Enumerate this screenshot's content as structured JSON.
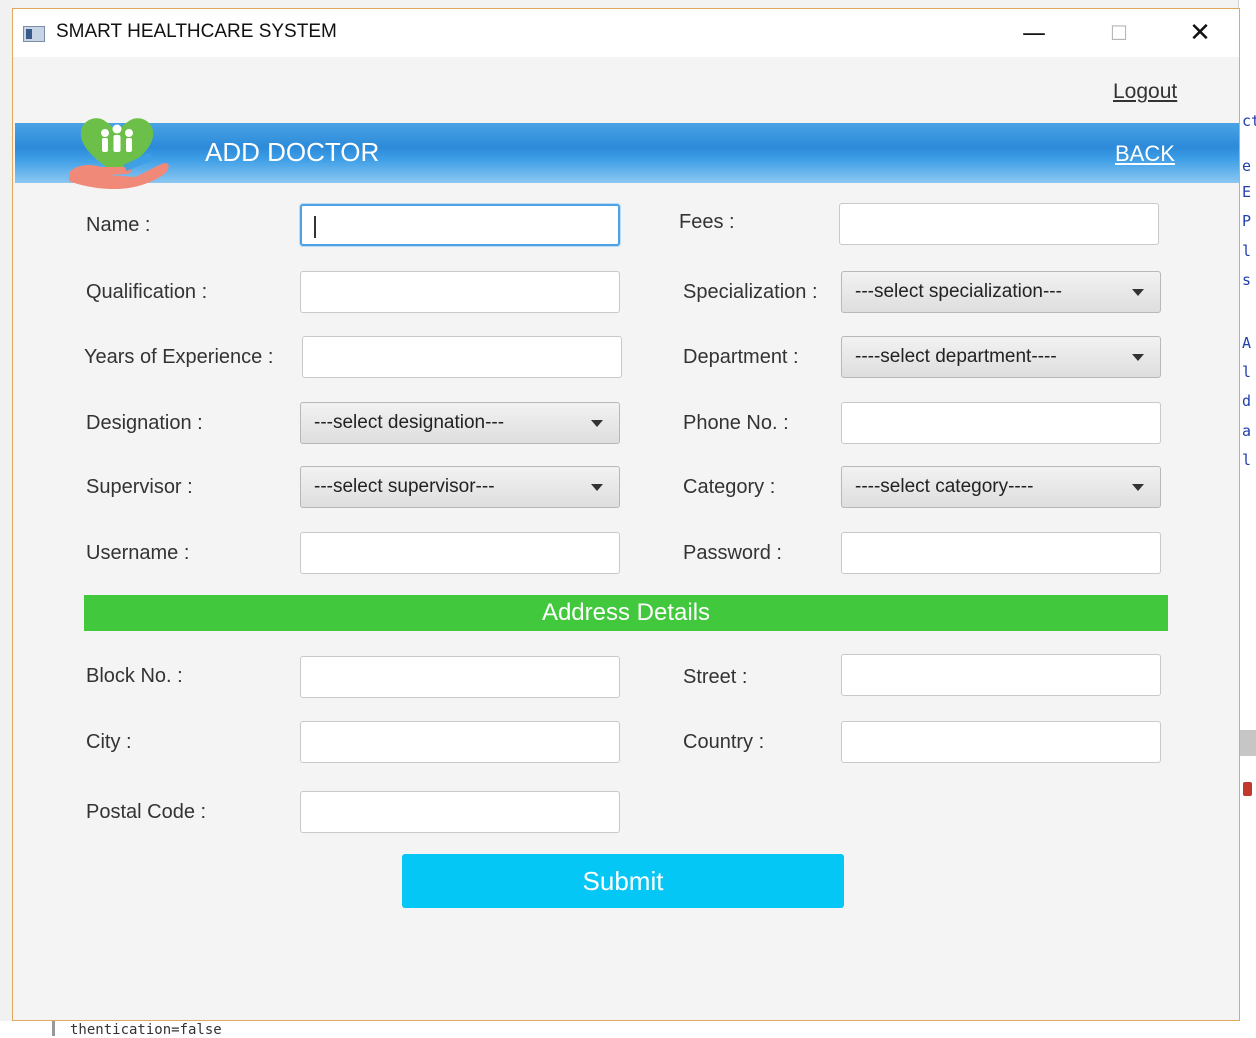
{
  "window": {
    "title": "SMART HEALTHCARE SYSTEM",
    "minimize": "—",
    "maximize": "☐",
    "close": "✕"
  },
  "header": {
    "logout": "Logout",
    "page_title": "ADD DOCTOR",
    "back": "BACK"
  },
  "form": {
    "left": [
      {
        "label": "Name :",
        "type": "input",
        "value": ""
      },
      {
        "label": "Qualification :",
        "type": "input",
        "value": ""
      },
      {
        "label": "Years of Experience :",
        "type": "input",
        "value": ""
      },
      {
        "label": "Designation :",
        "type": "select",
        "value": "---select designation---"
      },
      {
        "label": "Supervisor :",
        "type": "select",
        "value": "---select supervisor---"
      },
      {
        "label": "Username :",
        "type": "input",
        "value": ""
      }
    ],
    "right": [
      {
        "label": "Fees :",
        "type": "input",
        "value": ""
      },
      {
        "label": "Specialization :",
        "type": "select",
        "value": "---select specialization---"
      },
      {
        "label": "Department :",
        "type": "select",
        "value": "----select department----"
      },
      {
        "label": "Phone No. :",
        "type": "input",
        "value": ""
      },
      {
        "label": "Category :",
        "type": "select",
        "value": "----select category----"
      },
      {
        "label": "Password :",
        "type": "input",
        "value": ""
      }
    ]
  },
  "address": {
    "section_title": "Address Details",
    "block_no_label": "Block No. :",
    "street_label": "Street :",
    "city_label": "City :",
    "country_label": "Country :",
    "postal_code_label": "Postal Code :"
  },
  "submit_label": "Submit",
  "background": {
    "right_code": [
      "ct",
      "e",
      "E",
      "P",
      "l",
      "s",
      "A",
      "l",
      "d",
      "a",
      "l"
    ],
    "bottom_code": "thentication=false"
  },
  "colors": {
    "header_blue": "#2c8ad9",
    "address_green": "#41c83d",
    "submit_cyan": "#05c7f5"
  }
}
